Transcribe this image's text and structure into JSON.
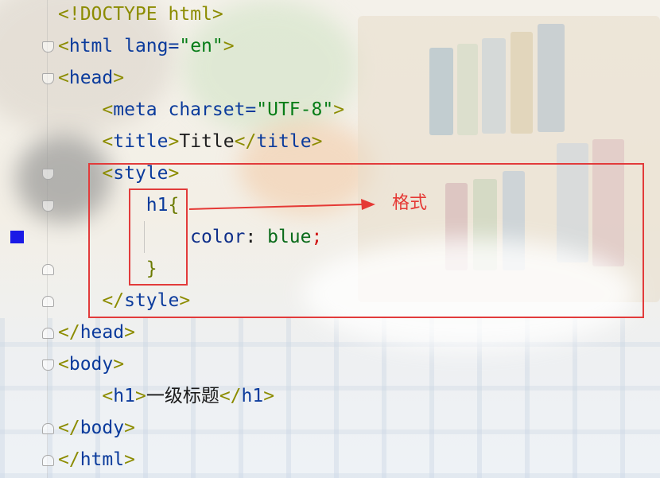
{
  "editor": {
    "lines": [
      {
        "parts": [
          {
            "t": "<!DOCTYPE html>",
            "c": "br"
          }
        ]
      },
      {
        "parts": [
          {
            "t": "<",
            "c": "br"
          },
          {
            "t": "html",
            "c": "tag"
          },
          {
            "t": " lang=",
            "c": "tag"
          },
          {
            "t": "\"en\"",
            "c": "str"
          },
          {
            "t": ">",
            "c": "br"
          }
        ]
      },
      {
        "parts": [
          {
            "t": "<",
            "c": "br"
          },
          {
            "t": "head",
            "c": "tag"
          },
          {
            "t": ">",
            "c": "br"
          }
        ]
      },
      {
        "parts": [
          {
            "t": "    <",
            "c": "br"
          },
          {
            "t": "meta",
            "c": "tag"
          },
          {
            "t": " charset=",
            "c": "tag"
          },
          {
            "t": "\"UTF-8\"",
            "c": "str"
          },
          {
            "t": ">",
            "c": "br"
          }
        ]
      },
      {
        "parts": [
          {
            "t": "    <",
            "c": "br"
          },
          {
            "t": "title",
            "c": "tag"
          },
          {
            "t": ">",
            "c": "br"
          },
          {
            "t": "Title",
            "c": "plain"
          },
          {
            "t": "</",
            "c": "br"
          },
          {
            "t": "title",
            "c": "tag"
          },
          {
            "t": ">",
            "c": "br"
          }
        ]
      },
      {
        "parts": [
          {
            "t": "    <",
            "c": "br"
          },
          {
            "t": "style",
            "c": "tag"
          },
          {
            "t": ">",
            "c": "br"
          }
        ]
      },
      {
        "parts": [
          {
            "t": "        h1",
            "c": "tag"
          },
          {
            "t": "{",
            "c": "sel"
          }
        ]
      },
      {
        "parts": [
          {
            "t": "            color",
            "c": "prop"
          },
          {
            "t": ": ",
            "c": "plain"
          },
          {
            "t": "blue",
            "c": "val"
          },
          {
            "t": ";",
            "c": "semi"
          }
        ]
      },
      {
        "parts": [
          {
            "t": "        }",
            "c": "sel"
          }
        ]
      },
      {
        "parts": [
          {
            "t": "    </",
            "c": "br"
          },
          {
            "t": "style",
            "c": "tag"
          },
          {
            "t": ">",
            "c": "br"
          }
        ]
      },
      {
        "parts": [
          {
            "t": "</",
            "c": "br"
          },
          {
            "t": "head",
            "c": "tag"
          },
          {
            "t": ">",
            "c": "br"
          }
        ]
      },
      {
        "parts": [
          {
            "t": "<",
            "c": "br"
          },
          {
            "t": "body",
            "c": "tag"
          },
          {
            "t": ">",
            "c": "br"
          }
        ]
      },
      {
        "parts": [
          {
            "t": "    <",
            "c": "br"
          },
          {
            "t": "h1",
            "c": "tag"
          },
          {
            "t": ">",
            "c": "br"
          },
          {
            "t": "一级标题",
            "c": "txt"
          },
          {
            "t": "</",
            "c": "br"
          },
          {
            "t": "h1",
            "c": "tag"
          },
          {
            "t": ">",
            "c": "br"
          }
        ]
      },
      {
        "parts": [
          {
            "t": "</",
            "c": "br"
          },
          {
            "t": "body",
            "c": "tag"
          },
          {
            "t": ">",
            "c": "br"
          }
        ]
      },
      {
        "parts": [
          {
            "t": "</",
            "c": "br"
          },
          {
            "t": "html",
            "c": "tag"
          },
          {
            "t": ">",
            "c": "br"
          }
        ]
      }
    ]
  },
  "annotation": {
    "label": "格式",
    "color": "#e53935"
  },
  "colors": {
    "tag": "#0b3b9c",
    "bracket": "#8c8c00",
    "string": "#067d17",
    "highlight_box": "#e23b3b",
    "bookmark": "#1a1ae6"
  }
}
